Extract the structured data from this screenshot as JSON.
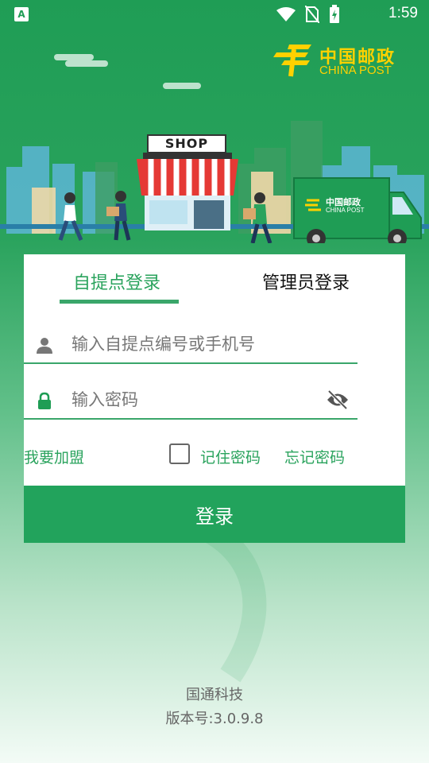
{
  "status_bar": {
    "app_icon_label": "A",
    "time": "1:59"
  },
  "logo": {
    "cn": "中国邮政",
    "en": "CHINA POST"
  },
  "scene": {
    "shop_sign": "SHOP",
    "truck_cn": "中国邮政",
    "truck_en": "CHINA POST"
  },
  "tabs": [
    {
      "label": "自提点登录",
      "active": true
    },
    {
      "label": "管理员登录",
      "active": false
    }
  ],
  "form": {
    "user_placeholder": "输入自提点编号或手机号",
    "user_value": "",
    "password_placeholder": "输入密码",
    "password_value": ""
  },
  "links": {
    "join": "我要加盟",
    "remember": "记住密码",
    "remember_checked": false,
    "forgot": "忘记密码"
  },
  "login_button": "登录",
  "footer": {
    "company": "国通科技",
    "version": "版本号:3.0.9.8"
  },
  "colors": {
    "primary": "#22a35c",
    "logo_yellow": "#ffd100"
  }
}
